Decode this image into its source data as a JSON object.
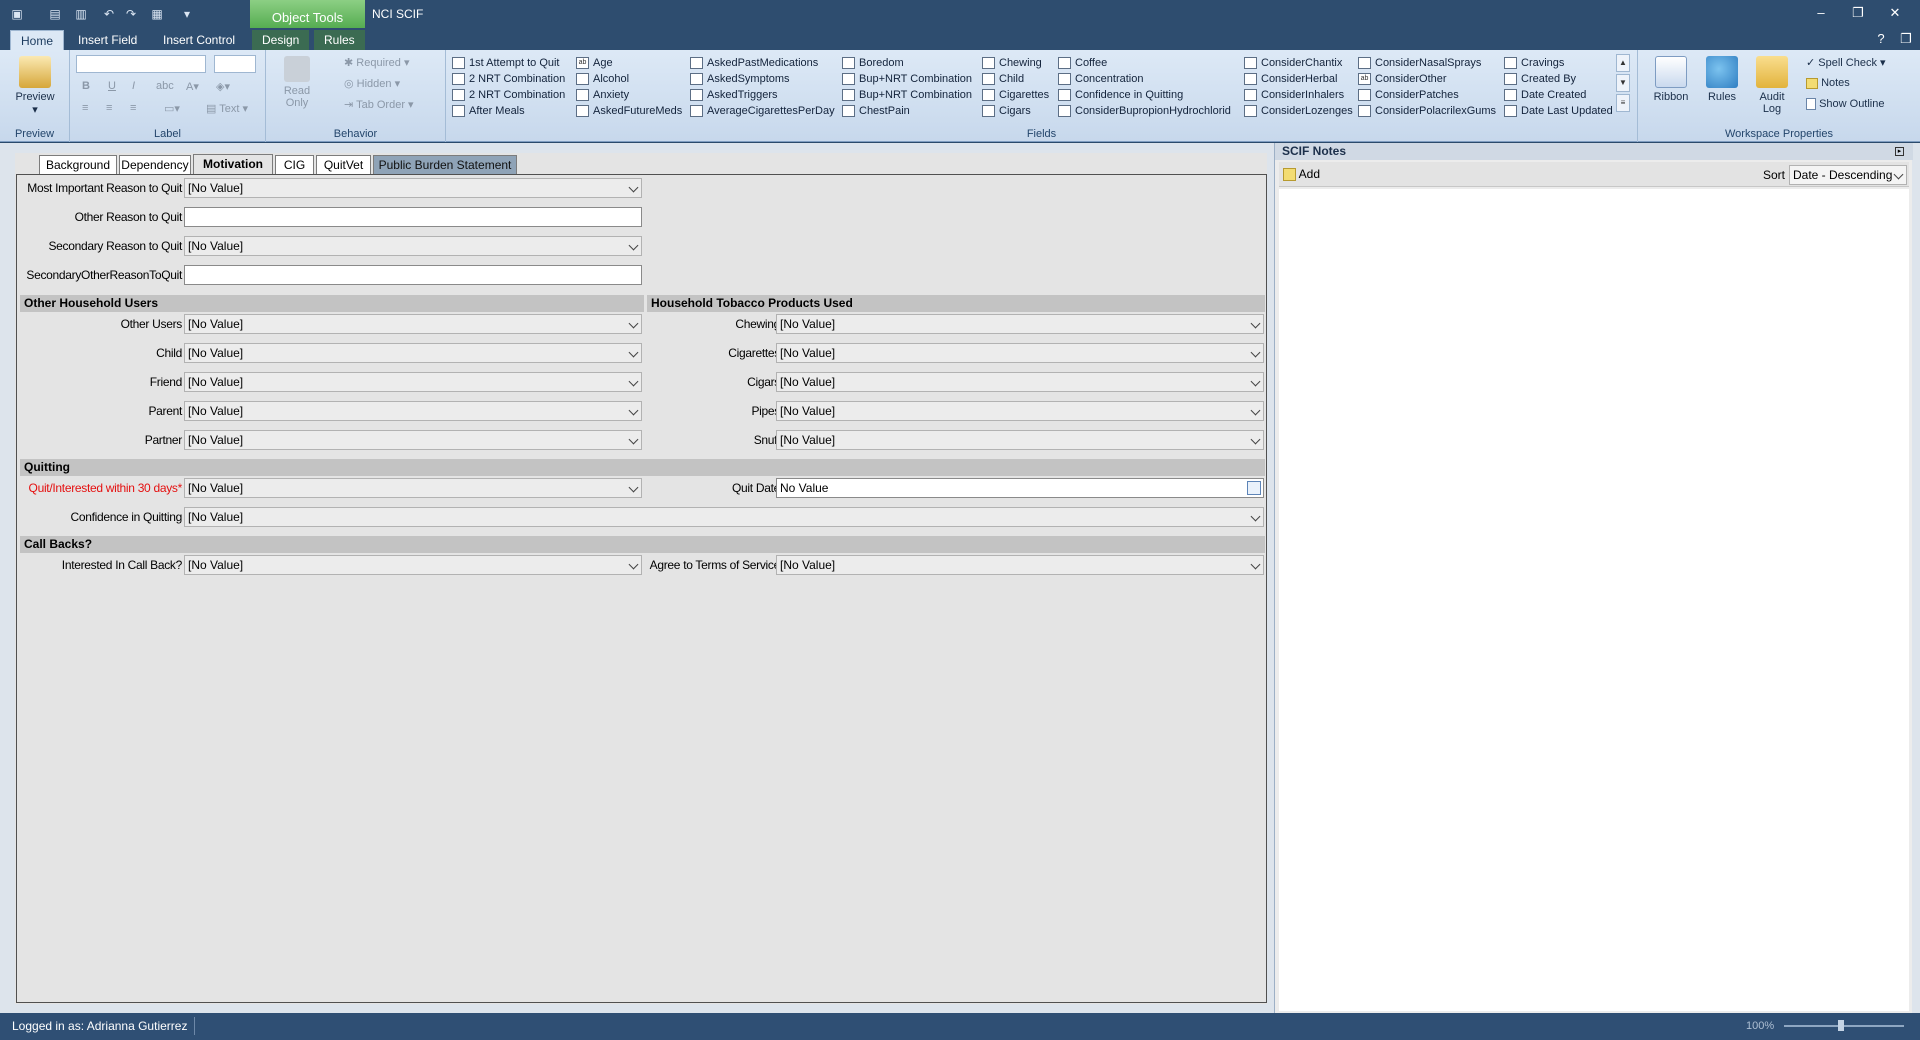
{
  "window": {
    "app_title": "NCI SCIF",
    "context_group": "Object Tools",
    "buttons": {
      "minimize": "–",
      "restore": "❐",
      "close": "✕"
    }
  },
  "ribbon_tabs": [
    "Home",
    "Insert Field",
    "Insert Control",
    "Design",
    "Rules"
  ],
  "ribbon": {
    "preview": {
      "label": "Preview",
      "group": "Preview"
    },
    "label_group": {
      "text_btn": "Text",
      "group": "Label"
    },
    "behavior": {
      "read_only": "Read Only",
      "required": "Required",
      "hidden": "Hidden",
      "tab_order": "Tab Order",
      "group": "Behavior"
    },
    "fields_group": "Fields",
    "fields": [
      [
        "1st Attempt to Quit",
        "2 NRT Combination",
        "2 NRT Combination",
        "After Meals"
      ],
      [
        "Age",
        "Alcohol",
        "Anxiety",
        "AskedFutureMeds"
      ],
      [
        "AskedPastMedications",
        "AskedSymptoms",
        "AskedTriggers",
        "AverageCigarettesPerDay"
      ],
      [
        "Boredom",
        "Bup+NRT Combination",
        "Bup+NRT Combination",
        "ChestPain"
      ],
      [
        "Chewing",
        "Child",
        "Cigarettes",
        "Cigars"
      ],
      [
        "Coffee",
        "Concentration",
        "Confidence in Quitting",
        "ConsiderBupropionHydrochlorid"
      ],
      [
        "ConsiderChantix",
        "ConsiderHerbal",
        "ConsiderInhalers",
        "ConsiderLozenges"
      ],
      [
        "ConsiderNasalSprays",
        "ConsiderOther",
        "ConsiderPatches",
        "ConsiderPolacrilexGums"
      ],
      [
        "Cravings",
        "Created By",
        "Date Created",
        "Date Last Updated"
      ]
    ],
    "workspace": {
      "ribbon": "Ribbon",
      "rules": "Rules",
      "audit_log": "Audit Log",
      "spell_check": "Spell Check",
      "notes": "Notes",
      "show_outline": "Show Outline",
      "group": "Workspace Properties"
    }
  },
  "form_tabs": [
    "Background",
    "Dependency",
    "Motivation",
    "CIG",
    "QuitVet",
    "Public Burden Statement"
  ],
  "form": {
    "no_value": "[No Value]",
    "most_important": "Most Important Reason to Quit",
    "other_reason": "Other Reason to Quit",
    "secondary_reason": "Secondary Reason to Quit",
    "secondary_other": "SecondaryOtherReasonToQuit",
    "sec_household_users": "Other Household Users",
    "sec_tobacco": "Household Tobacco Products Used",
    "users": [
      "Other Users",
      "Child",
      "Friend",
      "Parent",
      "Partner"
    ],
    "tobacco": [
      "Chewing",
      "Cigarettes",
      "Cigars",
      "Pipes",
      "Snuff"
    ],
    "sec_quitting": "Quitting",
    "quit_interested": "Quit/Interested within 30 days*",
    "quit_date": "Quit Date",
    "quit_date_value": "No Value",
    "confidence": "Confidence in Quitting",
    "sec_callbacks": "Call Backs?",
    "callback": "Interested In Call Back?",
    "terms": "Agree to Terms of Service"
  },
  "notes": {
    "title": "SCIF Notes",
    "add": "Add",
    "sort_label": "Sort",
    "sort_value": "Date - Descending"
  },
  "status": {
    "logged_in": "Logged in as: Adrianna Gutierrez",
    "zoom": "100%"
  }
}
